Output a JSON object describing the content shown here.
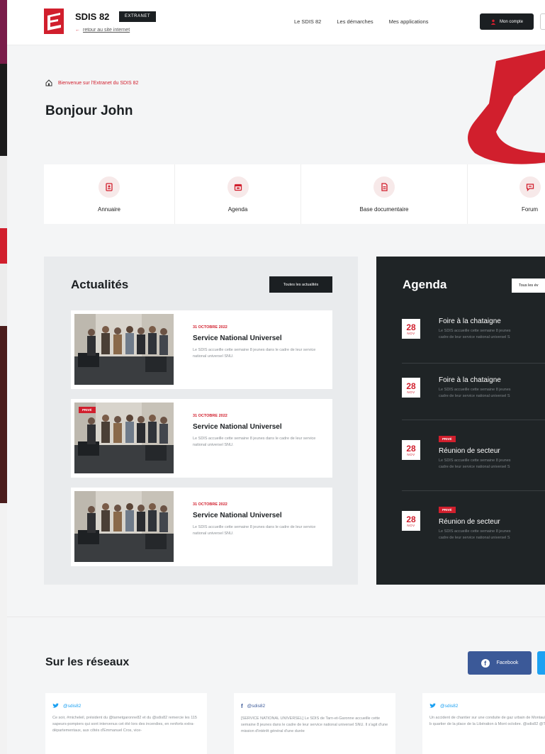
{
  "header": {
    "brand": "SDIS 82",
    "badge": "EXTRANET",
    "back_link": "retour au site internet",
    "nav": [
      "Le SDIS 82",
      "Les démarches",
      "Mes applications"
    ],
    "account_button": "Mon compte"
  },
  "hero": {
    "breadcrumb": "Bienvenue sur l'Extranet du SDIS 82",
    "greeting": "Bonjour John"
  },
  "quick_links": [
    {
      "label": "Annuaire",
      "icon": "contacts-icon"
    },
    {
      "label": "Agenda",
      "icon": "calendar-icon"
    },
    {
      "label": "Base documentaire",
      "icon": "document-icon"
    },
    {
      "label": "Forum",
      "icon": "chat-icon"
    }
  ],
  "actualites": {
    "title": "Actualités",
    "all_button": "Toutes les actualités",
    "items": [
      {
        "date": "31 OCTOBRE 2022",
        "title": "Service National Universel",
        "desc": "Le SDIS accueille cette semaine 8 jeunes dans le cadre de leur service national universel SNU.",
        "private": false
      },
      {
        "date": "31 OCTOBRE 2022",
        "title": "Service National Universel",
        "desc": "Le SDIS accueille cette semaine 8 jeunes dans le cadre de leur service national universel SNU.",
        "private": true
      },
      {
        "date": "31 OCTOBRE 2022",
        "title": "Service National Universel",
        "desc": "Le SDIS accueille cette semaine 8 jeunes dans le cadre de leur service national universel SNU.",
        "private": false
      }
    ],
    "private_label": "PRIVÉ"
  },
  "agenda": {
    "title": "Agenda",
    "all_button": "Tous les év",
    "events": [
      {
        "day": "28",
        "month": "NOV",
        "title": "Foire à la chataigne",
        "desc1": "Le SDIS accueille cette semaine 8 jeunes",
        "desc2": "cadre de leur service national universel S",
        "private": false
      },
      {
        "day": "28",
        "month": "NOV",
        "title": "Foire à la chataigne",
        "desc1": "Le SDIS accueille cette semaine 8 jeunes",
        "desc2": "cadre de leur service national universel S",
        "private": false
      },
      {
        "day": "28",
        "month": "NOV",
        "title": "Réunion de secteur",
        "desc1": "Le SDIS accueille cette semaine 8 jeunes",
        "desc2": "cadre de leur service national universel S",
        "private": true
      },
      {
        "day": "28",
        "month": "NOV",
        "title": "Réunion de secteur",
        "desc1": "Le SDIS accueille cette semaine 8 jeunes",
        "desc2": "cadre de leur service national universel S",
        "private": true
      }
    ]
  },
  "reseaux": {
    "title": "Sur les réseaux",
    "facebook_button": "Facebook",
    "posts": [
      {
        "network": "twitter",
        "handle": "@sdis82",
        "body": "Ce soir, #micheleil, président du @tarnetgaronne82 et du @sdis82 remercie les 115 sapeurs-pompiers qui sont intervenus cet été lors des incendies, en renforts extra-départementaux, aux côtés d'Emmanuel Cros, vice-"
      },
      {
        "network": "facebook",
        "handle": "@sdis82",
        "body": "[SERVICE NATIONAL UNIVERSEL] Le SDIS de Tarn-et-Garonne accueille cette semaine 8 jeunes dans le cadre de leur service national universel SNU. Il s'agit d'une mission d'intérêt général d'une durée"
      },
      {
        "network": "twitter",
        "handle": "@sdis82",
        "body": "Un accident de chantier sur une conduite de gaz urbain de Montauban, a provoqué le b quartier de la place de la Libération à Mont octobre. @sdis82 @THERON_sdis82"
      }
    ]
  },
  "colors": {
    "accent": "#d11f2d",
    "dark": "#1b1f22",
    "facebook": "#3b5998",
    "twitter": "#1da1f2"
  }
}
